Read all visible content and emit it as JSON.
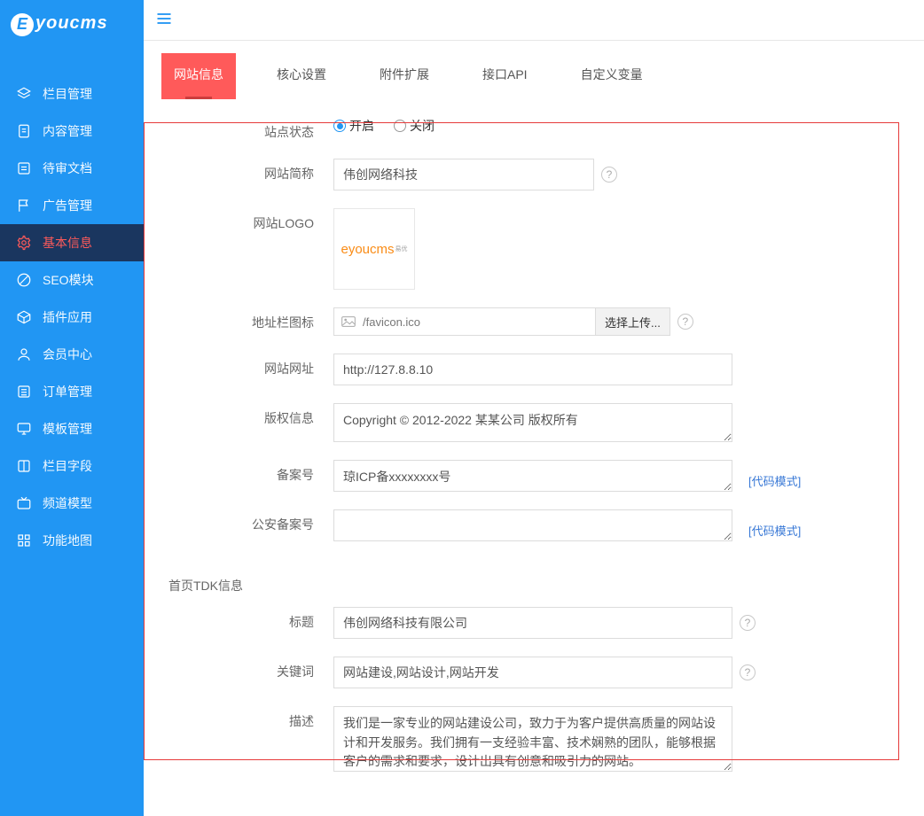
{
  "brand": {
    "mark": "E",
    "name": "youcms"
  },
  "sidebar": {
    "items": [
      {
        "label": "栏目管理",
        "icon": "layers"
      },
      {
        "label": "内容管理",
        "icon": "file-text"
      },
      {
        "label": "待审文档",
        "icon": "inbox"
      },
      {
        "label": "广告管理",
        "icon": "flag"
      },
      {
        "label": "基本信息",
        "icon": "gear",
        "active": true
      },
      {
        "label": "SEO模块",
        "icon": "circle-slash"
      },
      {
        "label": "插件应用",
        "icon": "box"
      },
      {
        "label": "会员中心",
        "icon": "user"
      },
      {
        "label": "订单管理",
        "icon": "list"
      },
      {
        "label": "模板管理",
        "icon": "monitor"
      },
      {
        "label": "栏目字段",
        "icon": "columns"
      },
      {
        "label": "频道模型",
        "icon": "tv"
      },
      {
        "label": "功能地图",
        "icon": "grid"
      }
    ]
  },
  "tabs": [
    {
      "label": "网站信息",
      "active": true
    },
    {
      "label": "核心设置"
    },
    {
      "label": "附件扩展"
    },
    {
      "label": "接口API"
    },
    {
      "label": "自定义变量"
    }
  ],
  "status": {
    "label": "站点状态",
    "on": "开启",
    "off": "关闭",
    "value": "on"
  },
  "short": {
    "label": "网站简称",
    "value": "伟创网络科技"
  },
  "logo": {
    "label": "网站LOGO",
    "brand": "eyoucms",
    "tiny": "易优"
  },
  "favicon": {
    "label": "地址栏图标",
    "value": "/favicon.ico",
    "btn": "选择上传..."
  },
  "url": {
    "label": "网站网址",
    "value": "http://127.8.8.10"
  },
  "copy": {
    "label": "版权信息",
    "value": "Copyright © 2012-2022 某某公司 版权所有"
  },
  "icp": {
    "label": "备案号",
    "value": "琼ICP备xxxxxxxx号",
    "code": "[代码模式]"
  },
  "police": {
    "label": "公安备案号",
    "value": "",
    "code": "[代码模式]"
  },
  "tdk": {
    "heading": "首页TDK信息"
  },
  "title": {
    "label": "标题",
    "value": "伟创网络科技有限公司"
  },
  "keyw": {
    "label": "关键词",
    "value": "网站建设,网站设计,网站开发"
  },
  "desc": {
    "label": "描述",
    "value": "我们是一家专业的网站建设公司，致力于为客户提供高质量的网站设计和开发服务。我们拥有一支经验丰富、技术娴熟的团队，能够根据客户的需求和要求，设计出具有创意和吸引力的网站。"
  }
}
